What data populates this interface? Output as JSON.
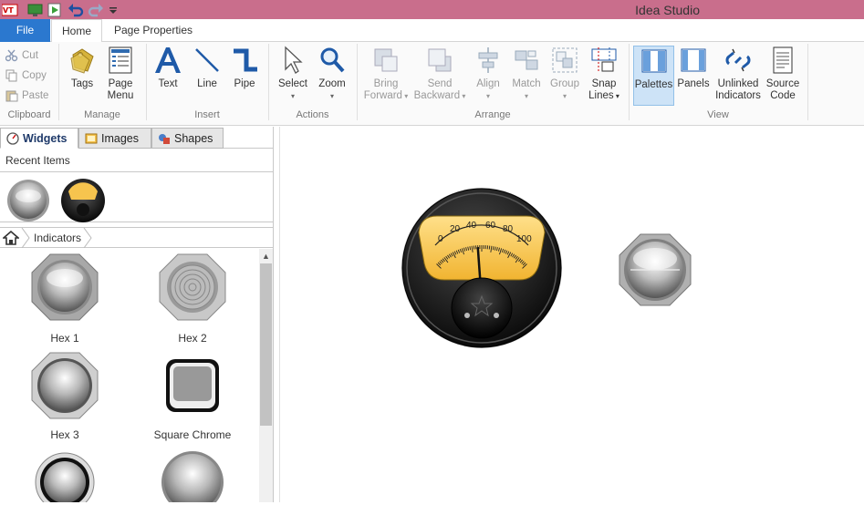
{
  "window": {
    "title": "Idea Studio"
  },
  "menu_tabs": {
    "file": "File",
    "home": "Home",
    "page_properties": "Page Properties"
  },
  "ribbon": {
    "clipboard": {
      "cut": "Cut",
      "copy": "Copy",
      "paste": "Paste",
      "label": "Clipboard"
    },
    "manage": {
      "tags": "Tags",
      "page_menu_1": "Page",
      "page_menu_2": "Menu",
      "label": "Manage"
    },
    "insert": {
      "text": "Text",
      "line": "Line",
      "pipe": "Pipe",
      "label": "Insert"
    },
    "actions": {
      "select": "Select",
      "zoom": "Zoom",
      "label": "Actions"
    },
    "arrange": {
      "bring_forward_1": "Bring",
      "bring_forward_2": "Forward",
      "send_backward_1": "Send",
      "send_backward_2": "Backward",
      "align": "Align",
      "match": "Match",
      "group": "Group",
      "snap_lines_1": "Snap",
      "snap_lines_2": "Lines",
      "label": "Arrange"
    },
    "view": {
      "palettes": "Palettes",
      "panels": "Panels",
      "unlinked_1": "Unlinked",
      "unlinked_2": "Indicators",
      "source_1": "Source",
      "source_2": "Code",
      "label": "View"
    }
  },
  "palette": {
    "tabs": {
      "widgets": "Widgets",
      "images": "Images",
      "shapes": "Shapes"
    },
    "recent_label": "Recent Items",
    "breadcrumb": "Indicators",
    "items": [
      {
        "label": "Hex 1"
      },
      {
        "label": "Hex 2"
      },
      {
        "label": "Hex 3"
      },
      {
        "label": "Square Chrome"
      },
      {
        "label": ""
      },
      {
        "label": ""
      }
    ]
  },
  "gauge": {
    "ticks": [
      "0",
      "20",
      "40",
      "60",
      "80",
      "100"
    ],
    "value": 46
  },
  "colors": {
    "titlebar": "#c96e8c",
    "file_tab": "#2b78cf",
    "gauge_face": "#f6c44e"
  }
}
